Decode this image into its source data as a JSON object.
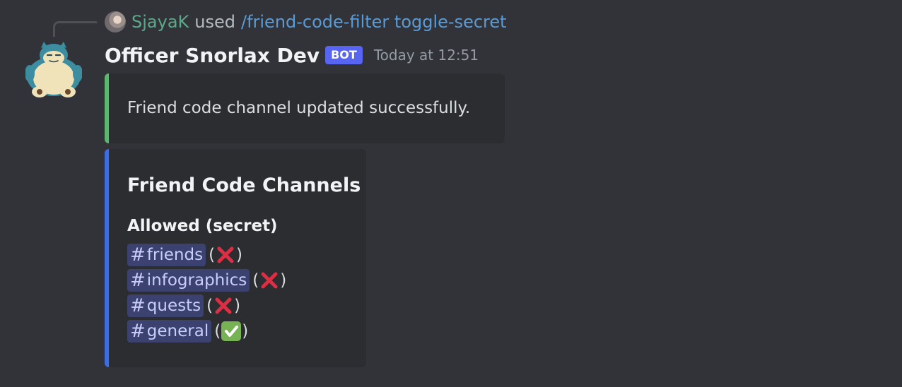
{
  "reply": {
    "user": "SjayaK",
    "used": "used",
    "command": "/friend-code-filter toggle-secret"
  },
  "message": {
    "author": "Officer Snorlax Dev",
    "bot_tag": "BOT",
    "timestamp": "Today at 12:51"
  },
  "embed1": {
    "description": "Friend code channel updated successfully.",
    "accent_color": "#57b96c"
  },
  "embed2": {
    "title": "Friend Code Channels",
    "field_name": "Allowed (secret)",
    "accent_color": "#3a6ee8",
    "channels": [
      {
        "name": "friends",
        "status": "cross-mark-icon"
      },
      {
        "name": "infographics",
        "status": "cross-mark-icon"
      },
      {
        "name": "quests",
        "status": "cross-mark-icon"
      },
      {
        "name": "general",
        "status": "check-mark-icon"
      }
    ]
  },
  "colors": {
    "background": "#313338",
    "embed_background": "#2b2d31",
    "mention_background": "#3c4270",
    "bot_tag": "#5865f2",
    "reply_user": "#5ea88a",
    "command": "#5b9bd5"
  }
}
